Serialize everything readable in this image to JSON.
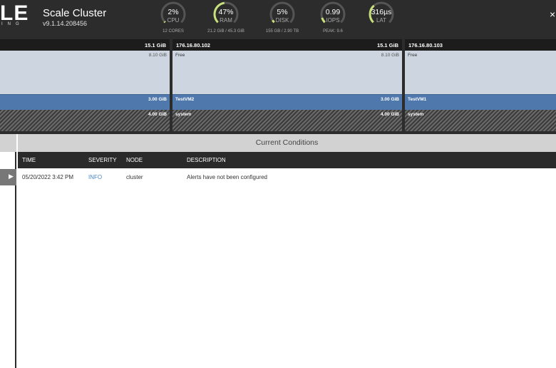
{
  "header": {
    "logo_text": "LE",
    "logo_sub": "ING",
    "cluster_name": "Scale Cluster",
    "version": "v9.1.14.208456",
    "close_glyph": "×",
    "gauges": [
      {
        "id": "cpu",
        "value": "2%",
        "label": "CPU",
        "sub": "12 CORES",
        "level": 0.02,
        "color": "#c8e07a"
      },
      {
        "id": "ram",
        "value": "47%",
        "label": "RAM",
        "sub": "21.2 GiB / 45.3 GiB",
        "level": 0.47,
        "color": "#c8e07a"
      },
      {
        "id": "disk",
        "value": "5%",
        "label": "DISK",
        "sub": "155 GB / 2.90 TB",
        "level": 0.05,
        "color": "#c8e07a"
      },
      {
        "id": "iops",
        "value": "0.99",
        "label": "IOPS",
        "sub": "PEAK: 9.6",
        "level": 0.1,
        "color": "#c8e07a"
      },
      {
        "id": "lat",
        "value": "316µs",
        "label": "LAT",
        "sub": "",
        "level": 0.35,
        "color": "#c8e07a"
      }
    ]
  },
  "nodes": [
    {
      "ip": "",
      "total": "15.1 GiB",
      "free_label": "",
      "free_value": "8.10 GiB",
      "vm_label": "",
      "vm_value": "3.00 GiB",
      "system_label": "",
      "system_value": "4.00 GiB"
    },
    {
      "ip": "176.16.80.102",
      "total": "15.1 GiB",
      "free_label": "Free",
      "free_value": "8.10 GiB",
      "vm_label": "TestVM2",
      "vm_value": "3.00 GiB",
      "system_label": "system",
      "system_value": "4.00 GiB"
    },
    {
      "ip": "176.16.80.103",
      "total": "",
      "free_label": "Free",
      "free_value": "",
      "vm_label": "TestVM1",
      "vm_value": "",
      "system_label": "system",
      "system_value": ""
    }
  ],
  "left_panel": {
    "arrow_glyph": "▶"
  },
  "conditions": {
    "title": "Current Conditions",
    "columns": {
      "time": "TIME",
      "severity": "SEVERITY",
      "node": "NODE",
      "description": "DESCRIPTION"
    },
    "rows": [
      {
        "time": "05/20/2022 3:42 PM",
        "severity": "INFO",
        "node": "cluster",
        "description": "Alerts have not been configured"
      }
    ]
  },
  "colors": {
    "header_bg": "#2c2c2c",
    "gauge_accent": "#c8e07a",
    "vm_blue": "#4f79ad",
    "info_blue": "#4a86c5"
  }
}
